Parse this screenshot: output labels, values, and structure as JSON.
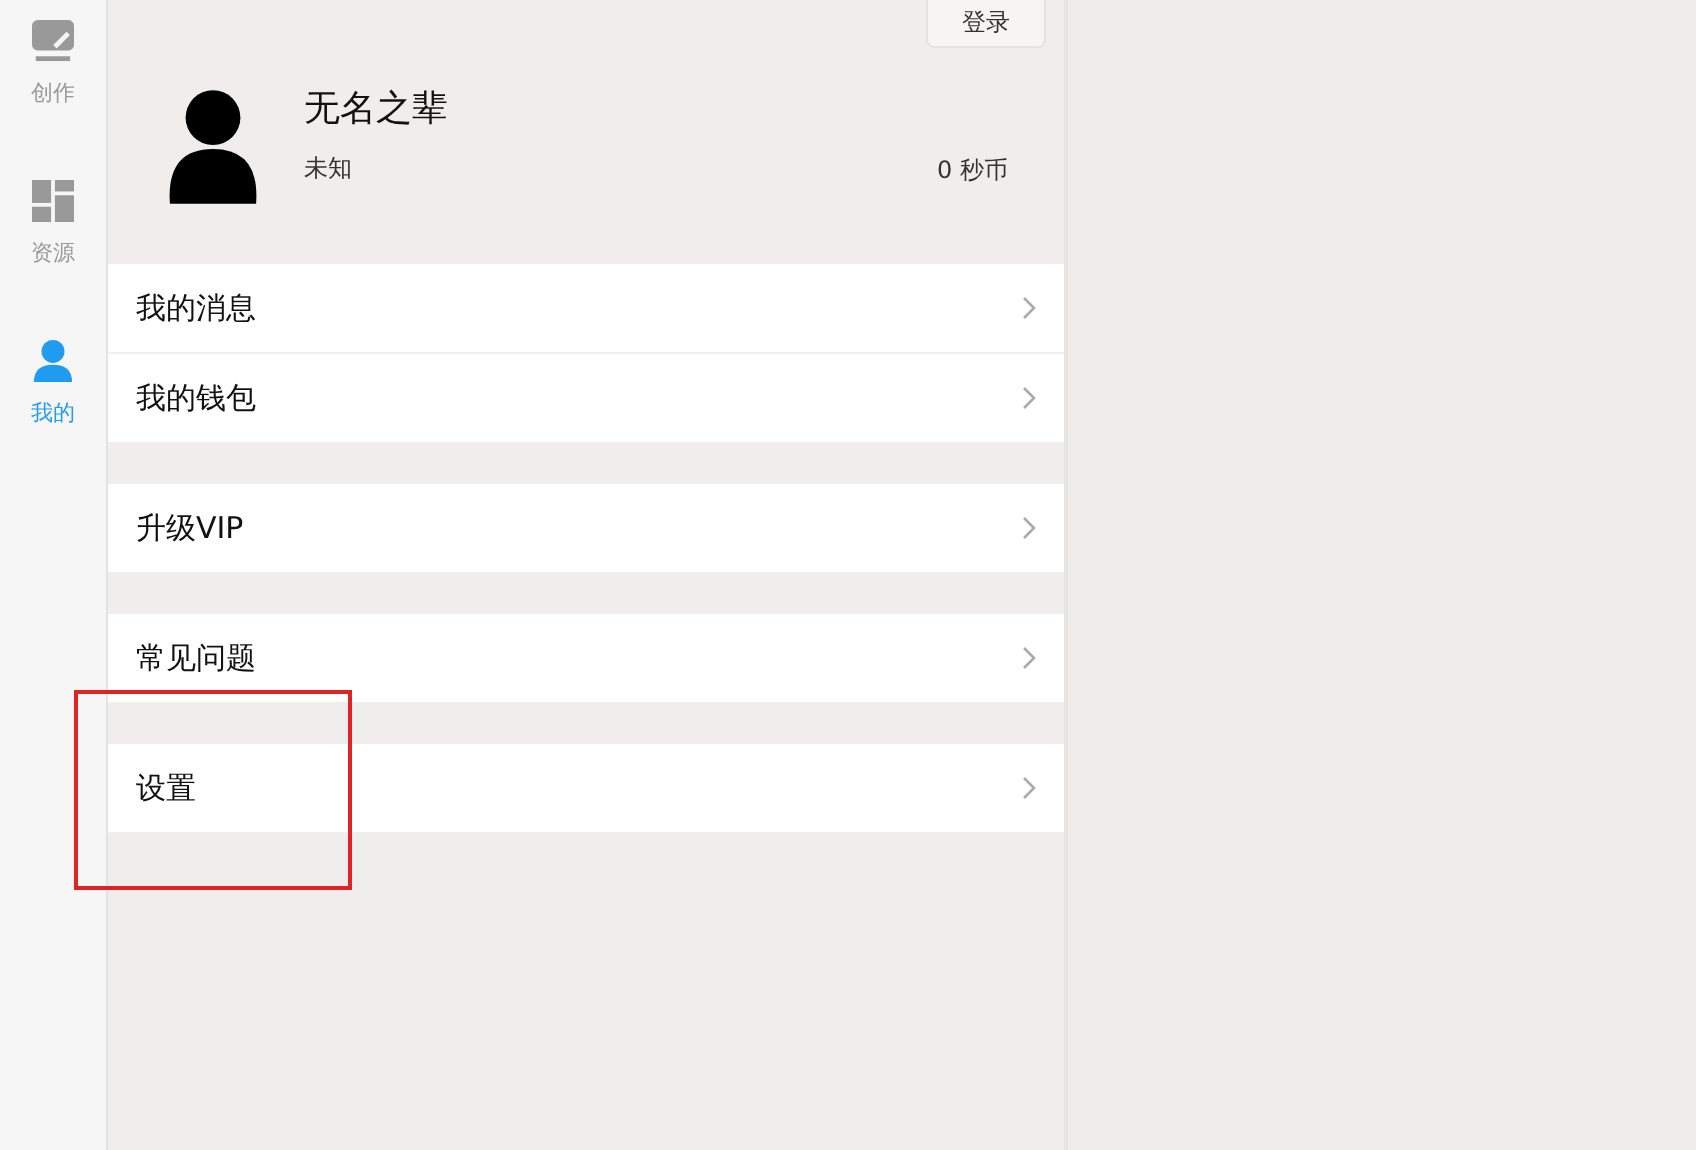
{
  "sidebar": {
    "items": [
      {
        "label": "创作",
        "selected": false
      },
      {
        "label": "资源",
        "selected": false
      },
      {
        "label": "我的",
        "selected": true
      }
    ]
  },
  "header": {
    "login_button": "登录",
    "username": "无名之辈",
    "subtitle": "未知",
    "coins": "0 秒币"
  },
  "menu_groups": [
    {
      "highlighted": false,
      "items": [
        {
          "label": "我的消息"
        },
        {
          "label": "我的钱包"
        }
      ]
    },
    {
      "highlighted": false,
      "items": [
        {
          "label": "升级VIP"
        }
      ]
    },
    {
      "highlighted": false,
      "items": [
        {
          "label": "常见问题"
        }
      ]
    },
    {
      "highlighted": true,
      "items": [
        {
          "label": "设置"
        }
      ]
    }
  ]
}
